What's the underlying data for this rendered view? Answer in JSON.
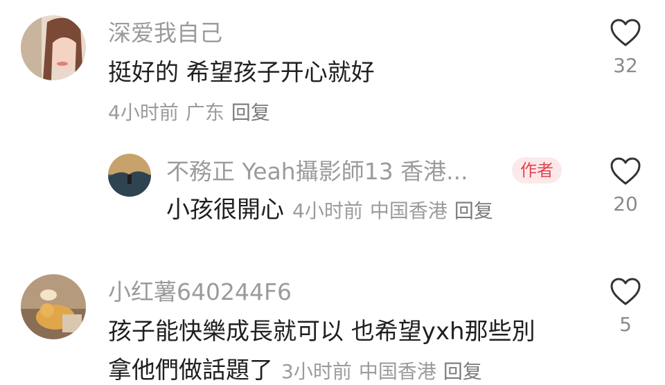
{
  "comments": [
    {
      "username": "深爱我自己",
      "text": "挺好的 希望孩子开心就好",
      "time": "4小时前",
      "location": "广东",
      "reply_label": "回复",
      "likes": "32"
    },
    {
      "username": "不務正 Yeah攝影師13 香港...",
      "badge": "作者",
      "text": "小孩很開心",
      "time": "4小时前",
      "location": "中国香港",
      "reply_label": "回复",
      "likes": "20"
    },
    {
      "username": "小红薯640244F6",
      "text_line1": "孩子能快樂成長就可以 也希望yxh那些別",
      "text_line2": "拿他們做話題了",
      "time": "3小时前",
      "location": "中国香港",
      "reply_label": "回复",
      "likes": "5"
    }
  ],
  "icons": {
    "like": "heart-outline-icon"
  },
  "colors": {
    "author_badge_bg": "#fde9ea",
    "author_badge_text": "#e0454f"
  }
}
